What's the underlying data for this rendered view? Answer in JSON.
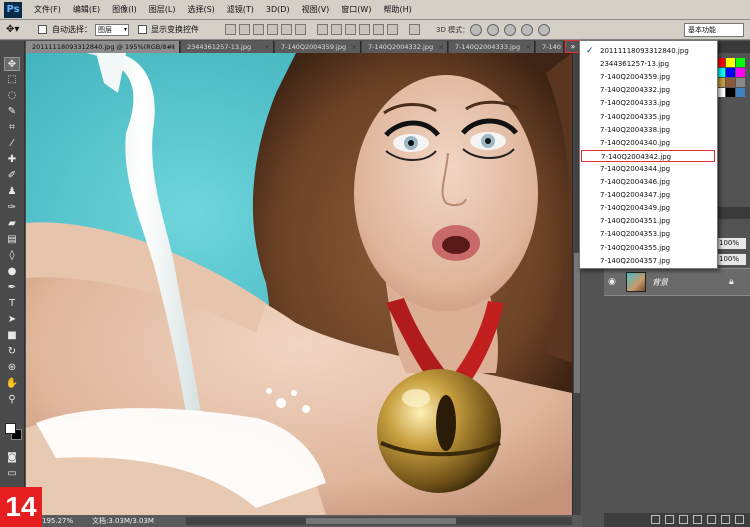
{
  "app": {
    "logo": "Ps"
  },
  "menu": [
    "文件(F)",
    "编辑(E)",
    "图像(I)",
    "图层(L)",
    "选择(S)",
    "滤镜(T)",
    "3D(D)",
    "视图(V)",
    "窗口(W)",
    "帮助(H)"
  ],
  "options": {
    "auto_select_label": "自动选择：",
    "auto_select_value": "图层",
    "show_transform_label": "显示变换控件",
    "mode_3d_label": "3D 模式：",
    "workspace": "基本功能"
  },
  "tabs": [
    {
      "label": "20111118093312840.jpg @ 195%(RGB/8#)",
      "close": "×"
    },
    {
      "label": "2344361257-13.jpg",
      "close": "×"
    },
    {
      "label": "7-140Q2004359.jpg",
      "close": "×"
    },
    {
      "label": "7-140Q2004332.jpg",
      "close": "×"
    },
    {
      "label": "7-140Q2004333.jpg",
      "close": "×"
    },
    {
      "label": "7-140",
      "close": ""
    }
  ],
  "overflow_button": "»",
  "dropdown": {
    "checked_index": 0,
    "highlight_index": 8,
    "items": [
      "20111118093312840.jpg",
      "2344361257-13.jpg",
      "7-140Q2004359.jpg",
      "7-140Q2004332.jpg",
      "7-140Q2004333.jpg",
      "7-140Q2004335.jpg",
      "7-140Q2004338.jpg",
      "7-140Q2004340.jpg",
      "7-140Q2004342.jpg",
      "7-140Q2004344.jpg",
      "7-140Q2004346.jpg",
      "7-140Q2004347.jpg",
      "7-140Q2004349.jpg",
      "7-140Q2004351.jpg",
      "7-140Q2004353.jpg",
      "7-140Q2004355.jpg",
      "7-140Q2004357.jpg"
    ]
  },
  "status": {
    "zoom": "195.27%",
    "doc": "文档:3.03M/3.03M"
  },
  "layers": {
    "layer_name": "背景",
    "opacity": "100%",
    "fill": "100%"
  },
  "badge": "14",
  "colors": {
    "highlight_border": "#e03030",
    "badge_bg": "#e51f1f",
    "canvas_bg": "#3fb5c0"
  }
}
